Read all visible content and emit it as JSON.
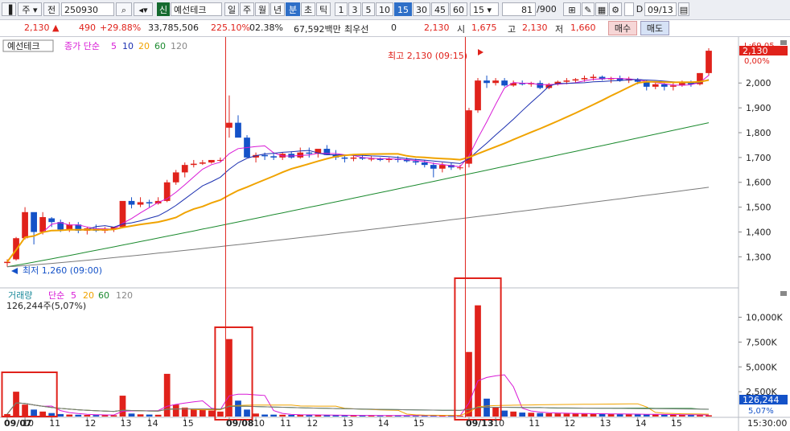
{
  "toolbar": {
    "market": "주",
    "prev_label": "전",
    "code": "250930",
    "credit_badge": "신",
    "stock_name": "예선테크",
    "period_day": "일",
    "period_week": "주",
    "period_month": "월",
    "period_year": "년",
    "period_minute": "분",
    "period_second": "초",
    "period_tick": "틱",
    "interval_1": "1",
    "interval_3": "3",
    "interval_5": "5",
    "interval_10": "10",
    "interval_15": "15",
    "interval_30": "30",
    "interval_45": "45",
    "interval_60": "60",
    "interval_value": "15",
    "count_display": "81",
    "count_total": "/900",
    "date_label": "D",
    "date_value": "09/13"
  },
  "quote": {
    "price": "2,130",
    "change": "490",
    "change_pct": "+29.88%",
    "volume": "33,785,506",
    "volume_ratio": "225.10%",
    "turnover": "02.38%",
    "amount": "67,592백만",
    "priority_label": "최우선",
    "priority_value": "0",
    "priority_price": "2,130",
    "open_label": "시",
    "open": "1,675",
    "high_label": "고",
    "high": "2,130",
    "low_label": "저",
    "low": "1,660",
    "buy_label": "매수",
    "sell_label": "매도"
  },
  "price_panel": {
    "name_box": "예선테크",
    "ma_label": "종가 단순",
    "ma_periods": [
      "5",
      "10",
      "20",
      "60",
      "120"
    ],
    "high_marker": "최고 2,130 (09:15)",
    "low_marker": "최저 1,260 (09:00)",
    "current_price_tag": "2,130",
    "top_right_label": "L:69.05",
    "top_pct_label": "0,00%"
  },
  "volume_panel": {
    "title": "거래량",
    "ma_label": "단순",
    "ma_periods": [
      "5",
      "20",
      "60",
      "120"
    ],
    "info": "126,244주(5,07%)",
    "current_tag": "126,244",
    "pct_label": "5,07%"
  },
  "time_axis": {
    "labels": [
      "09/07",
      "10",
      "11",
      "12",
      "13",
      "14",
      "15",
      "09/08",
      "10",
      "11",
      "12",
      "13",
      "14",
      "15",
      "09/13",
      "10",
      "11",
      "12",
      "13",
      "14",
      "15"
    ],
    "clock": "15:30:00"
  },
  "chart_data": [
    {
      "type": "candlestick",
      "title": "예선테크",
      "x_unit": "15-minute bar",
      "y_ticks": [
        1300,
        1400,
        1500,
        1600,
        1700,
        1800,
        1900,
        2000
      ],
      "ylim": [
        1230,
        2140
      ],
      "sessions": [
        "09/07",
        "09/08",
        "09/13"
      ],
      "ohlc": [
        [
          1275,
          1290,
          1260,
          1280
        ],
        [
          1290,
          1380,
          1285,
          1375
        ],
        [
          1375,
          1500,
          1370,
          1480
        ],
        [
          1480,
          1470,
          1350,
          1400
        ],
        [
          1400,
          1480,
          1390,
          1460
        ],
        [
          1455,
          1460,
          1420,
          1440
        ],
        [
          1440,
          1450,
          1400,
          1410
        ],
        [
          1410,
          1440,
          1400,
          1430
        ],
        [
          1430,
          1440,
          1395,
          1405
        ],
        [
          1405,
          1420,
          1390,
          1415
        ],
        [
          1415,
          1430,
          1400,
          1405
        ],
        [
          1405,
          1420,
          1395,
          1410
        ],
        [
          1410,
          1420,
          1400,
          1420
        ],
        [
          1420,
          1500,
          1415,
          1525
        ],
        [
          1525,
          1540,
          1495,
          1510
        ],
        [
          1510,
          1540,
          1500,
          1520
        ],
        [
          1520,
          1530,
          1500,
          1515
        ],
        [
          1515,
          1540,
          1510,
          1525
        ],
        [
          1525,
          1610,
          1520,
          1600
        ],
        [
          1600,
          1650,
          1590,
          1640
        ],
        [
          1640,
          1680,
          1620,
          1670
        ],
        [
          1670,
          1690,
          1660,
          1675
        ],
        [
          1675,
          1690,
          1670,
          1680
        ],
        [
          1680,
          1690,
          1675,
          1690
        ],
        [
          1690,
          1700,
          1680,
          1690
        ],
        [
          1820,
          1950,
          1780,
          1840
        ],
        [
          1840,
          1870,
          1800,
          1780
        ],
        [
          1780,
          1790,
          1700,
          1700
        ],
        [
          1700,
          1720,
          1680,
          1710
        ],
        [
          1710,
          1720,
          1690,
          1705
        ],
        [
          1705,
          1715,
          1690,
          1700
        ],
        [
          1700,
          1720,
          1690,
          1715
        ],
        [
          1715,
          1725,
          1695,
          1700
        ],
        [
          1700,
          1740,
          1695,
          1720
        ],
        [
          1720,
          1740,
          1700,
          1715
        ],
        [
          1715,
          1730,
          1700,
          1735
        ],
        [
          1735,
          1750,
          1720,
          1710
        ],
        [
          1710,
          1730,
          1690,
          1700
        ],
        [
          1700,
          1710,
          1680,
          1695
        ],
        [
          1695,
          1710,
          1685,
          1700
        ],
        [
          1700,
          1710,
          1690,
          1695
        ],
        [
          1695,
          1705,
          1685,
          1695
        ],
        [
          1695,
          1700,
          1685,
          1690
        ],
        [
          1690,
          1700,
          1680,
          1695
        ],
        [
          1695,
          1705,
          1680,
          1690
        ],
        [
          1690,
          1700,
          1680,
          1685
        ],
        [
          1685,
          1695,
          1670,
          1680
        ],
        [
          1680,
          1690,
          1660,
          1670
        ],
        [
          1670,
          1680,
          1620,
          1655
        ],
        [
          1655,
          1680,
          1640,
          1670
        ],
        [
          1670,
          1680,
          1650,
          1660
        ],
        [
          1660,
          1670,
          1650,
          1660
        ],
        [
          1675,
          1900,
          1660,
          1890
        ],
        [
          1890,
          2020,
          1880,
          2010
        ],
        [
          2010,
          2030,
          1980,
          2000
        ],
        [
          2000,
          2020,
          1990,
          2010
        ],
        [
          2010,
          2020,
          1985,
          1990
        ],
        [
          1990,
          2010,
          1985,
          2000
        ],
        [
          2000,
          2010,
          1990,
          1995
        ],
        [
          1995,
          2005,
          1985,
          2000
        ],
        [
          2000,
          2010,
          1975,
          1980
        ],
        [
          1980,
          2000,
          1975,
          1995
        ],
        [
          1995,
          2010,
          1990,
          2005
        ],
        [
          2005,
          2020,
          1995,
          2010
        ],
        [
          2010,
          2020,
          2000,
          2015
        ],
        [
          2015,
          2030,
          2005,
          2020
        ],
        [
          2020,
          2035,
          2010,
          2025
        ],
        [
          2025,
          2030,
          2010,
          2015
        ],
        [
          2015,
          2025,
          2000,
          2020
        ],
        [
          2020,
          2030,
          2005,
          2010
        ],
        [
          2010,
          2025,
          2000,
          2015
        ],
        [
          2015,
          2020,
          1995,
          2005
        ],
        [
          2005,
          2010,
          1970,
          1985
        ],
        [
          1985,
          2005,
          1975,
          1995
        ],
        [
          1995,
          2000,
          1970,
          1985
        ],
        [
          1985,
          2000,
          1970,
          1990
        ],
        [
          1990,
          2010,
          1985,
          2000
        ],
        [
          2000,
          2010,
          1985,
          1995
        ],
        [
          1995,
          2040,
          1990,
          2040
        ],
        [
          2040,
          2140,
          2030,
          2130
        ]
      ],
      "series": [
        {
          "name": "5",
          "color": "#d81ad6"
        },
        {
          "name": "10",
          "color": "#1b2fb0"
        },
        {
          "name": "20",
          "color": "#f0a300"
        },
        {
          "name": "60",
          "color": "#1b8a2e"
        },
        {
          "name": "120",
          "color": "#7a7a7a"
        }
      ]
    },
    {
      "type": "bar",
      "title": "거래량",
      "y_ticks": [
        5000,
        7500,
        10000
      ],
      "y_tick_labels": [
        "5,000K",
        "7,500K",
        "10,000K"
      ],
      "y_ticks_upper": [
        2500
      ],
      "y_tick_labels_upper": [
        "2,500K"
      ],
      "ylim": [
        0,
        11500
      ],
      "volume_k": [
        250,
        2500,
        1200,
        700,
        500,
        350,
        250,
        200,
        180,
        160,
        150,
        140,
        130,
        2100,
        300,
        220,
        200,
        180,
        4300,
        1200,
        900,
        800,
        700,
        600,
        500,
        7800,
        1600,
        700,
        300,
        200,
        190,
        180,
        170,
        160,
        150,
        140,
        130,
        120,
        115,
        110,
        105,
        100,
        100,
        100,
        95,
        95,
        90,
        90,
        85,
        85,
        80,
        80,
        6500,
        11200,
        1800,
        900,
        600,
        500,
        400,
        380,
        350,
        330,
        310,
        300,
        290,
        280,
        270,
        260,
        250,
        240,
        230,
        220,
        210,
        200,
        190,
        180,
        170,
        160,
        150,
        126
      ],
      "ma_series": [
        {
          "name": "5",
          "color": "#d81ad6"
        },
        {
          "name": "20",
          "color": "#f0a300"
        },
        {
          "name": "60",
          "color": "#1b8a2e"
        },
        {
          "name": "120",
          "color": "#7a7a7a"
        }
      ]
    }
  ],
  "colors": {
    "up": "#e0221b",
    "down": "#1452c8",
    "highlight_box": "#e0221b",
    "session_line": "#e0221b"
  }
}
